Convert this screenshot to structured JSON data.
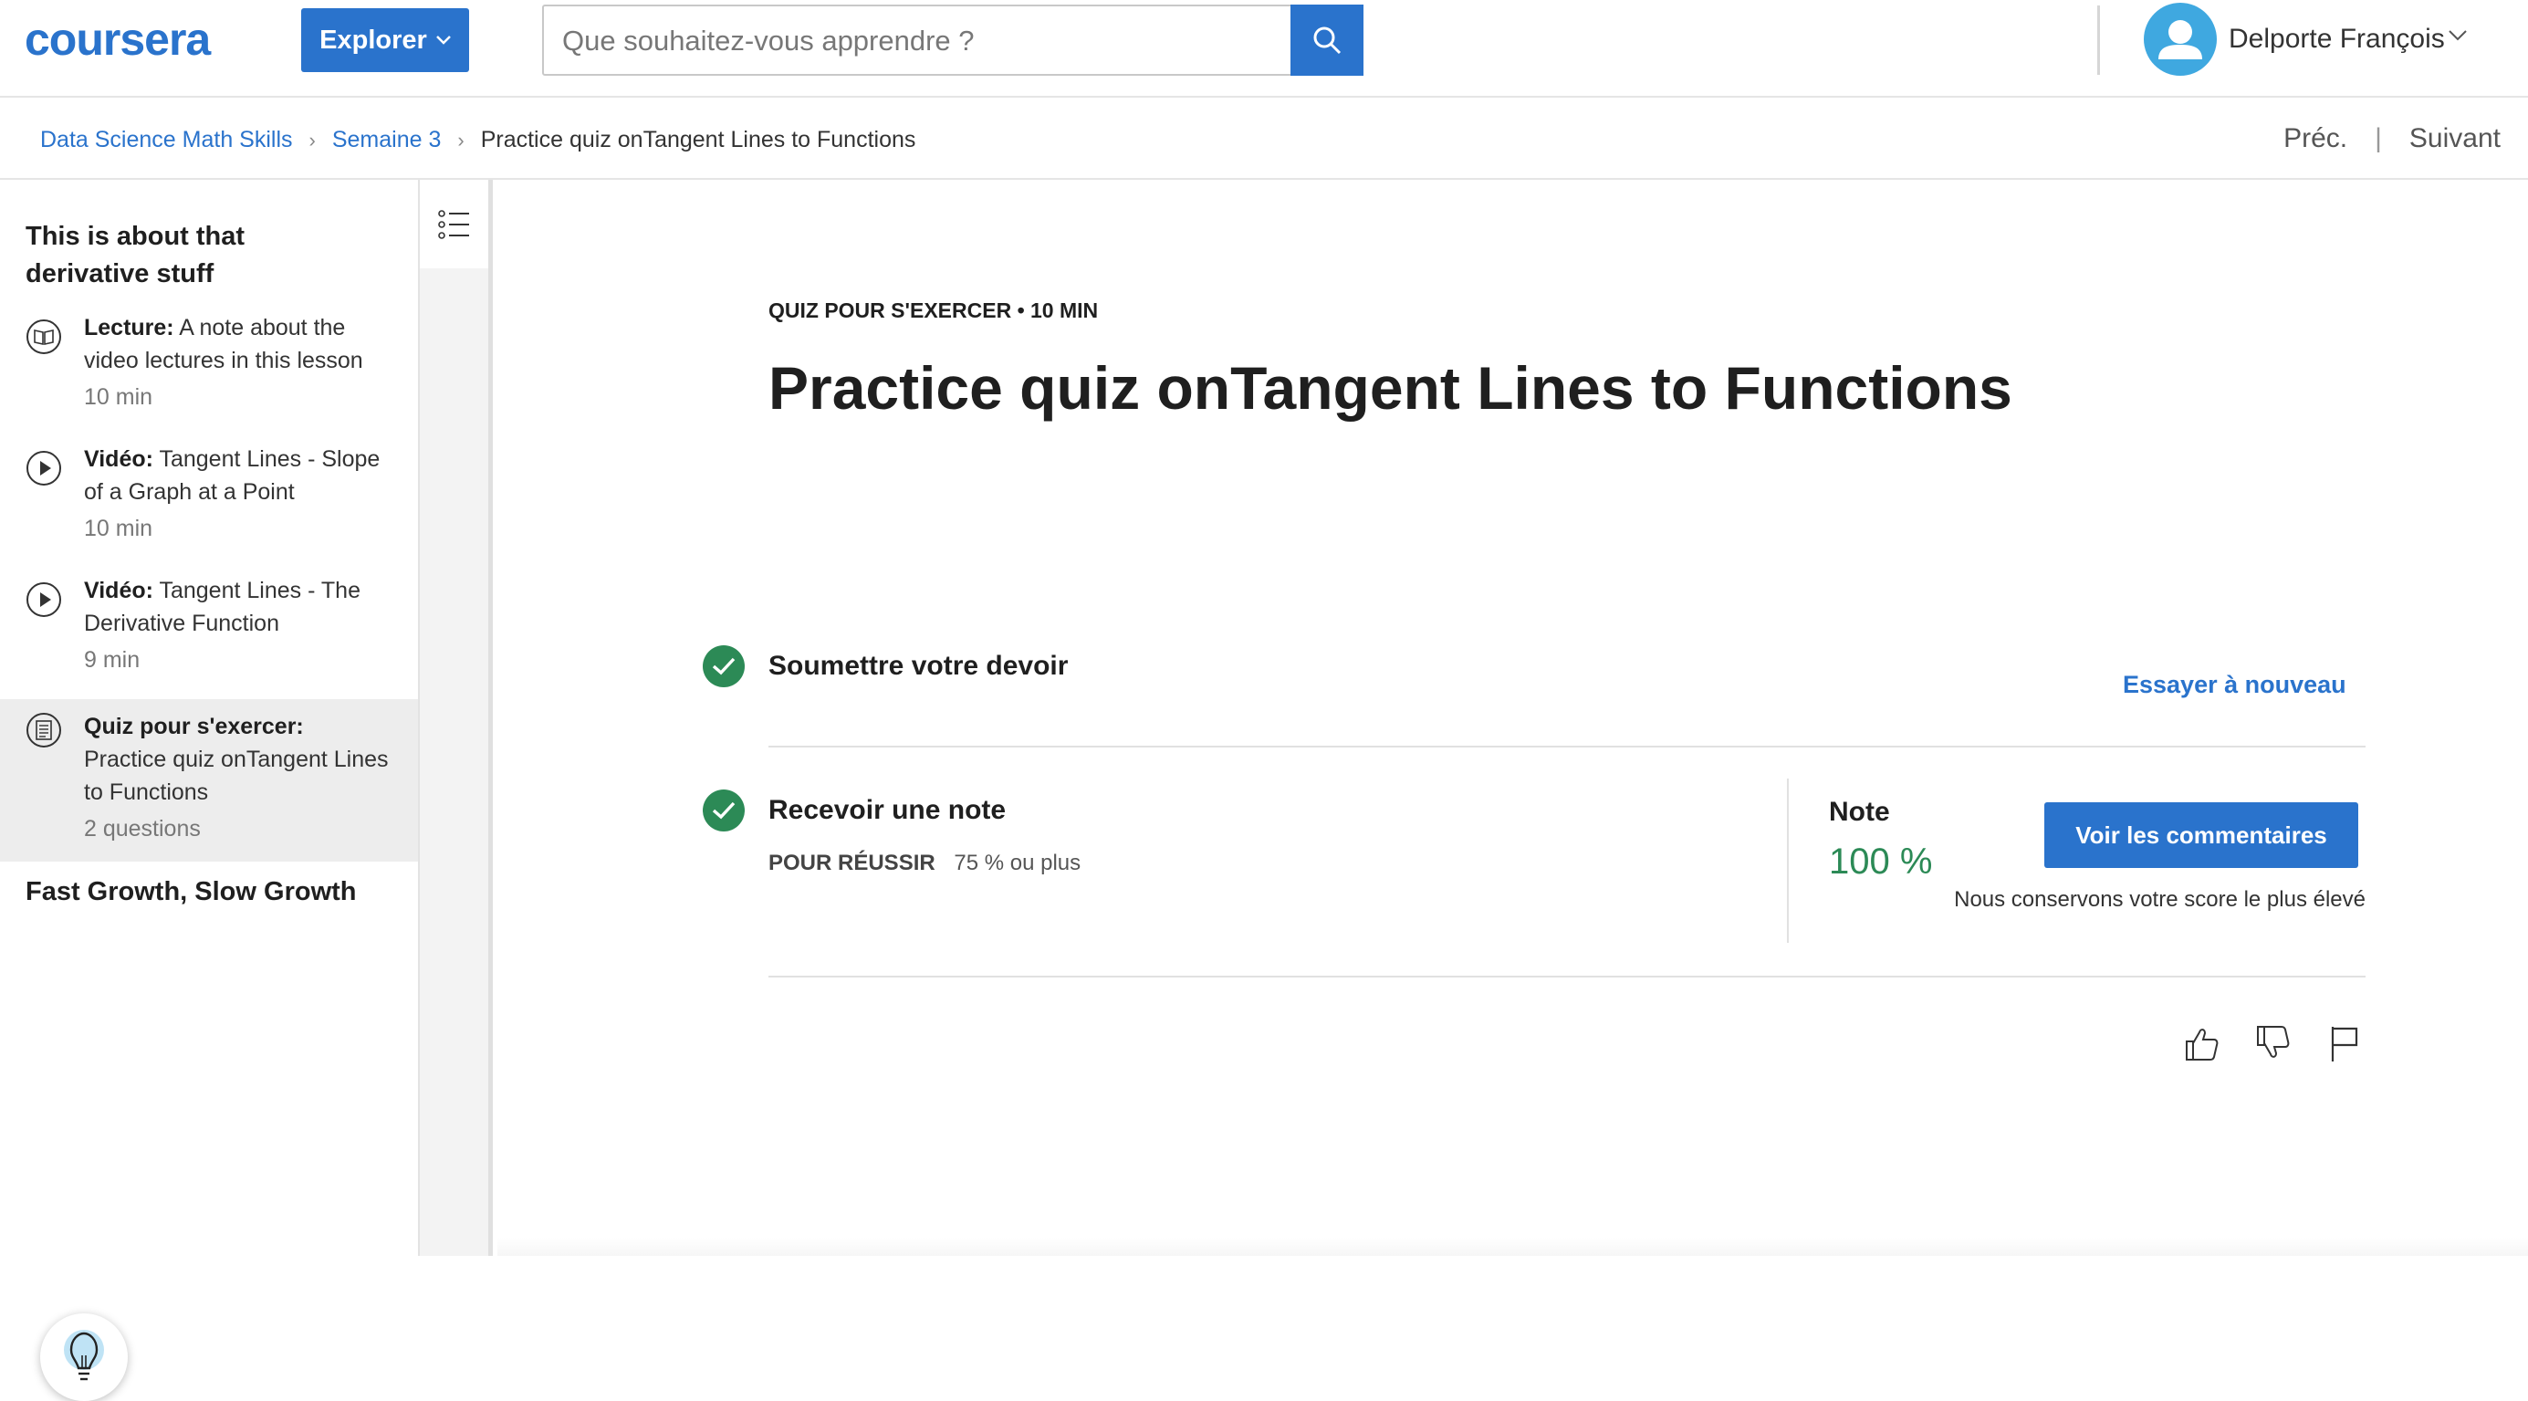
{
  "header": {
    "logo_text": "coursera",
    "explore_label": "Explorer",
    "search_placeholder": "Que souhaitez-vous apprendre ?",
    "user_name": "Delporte François"
  },
  "breadcrumb": {
    "items": [
      "Data Science Math Skills",
      "Semaine 3",
      "Practice quiz onTangent Lines to Functions"
    ],
    "prev_label": "Préc.",
    "next_label": "Suivant"
  },
  "sidebar": {
    "section_title": "This is about that derivative stuff",
    "items": [
      {
        "type": "Lecture:",
        "title": "A note about the video lectures in this lesson",
        "meta": "10  min",
        "icon": "reading-icon"
      },
      {
        "type": "Vidéo:",
        "title": "Tangent Lines - Slope of a Graph at a Point",
        "meta": "10  min",
        "icon": "play-icon"
      },
      {
        "type": "Vidéo:",
        "title": "Tangent Lines - The Derivative Function",
        "meta": "9  min",
        "icon": "play-icon"
      },
      {
        "type": "Quiz pour s'exercer:",
        "title": "Practice quiz onTangent Lines to Functions",
        "meta": "2 questions",
        "icon": "quiz-icon",
        "active": true
      }
    ],
    "next_section_title": "Fast Growth, Slow Growth"
  },
  "main": {
    "kicker": "QUIZ POUR S'EXERCER • 10  MIN",
    "title": "Practice quiz onTangent Lines to Functions",
    "submit_step": "Soumettre votre devoir",
    "retry_label": "Essayer à nouveau",
    "grade_step": "Recevoir une note",
    "pass_label": "POUR RÉUSSIR",
    "pass_value": "75 % ou plus",
    "note_label": "Note",
    "note_value": "100 %",
    "feedback_button": "Voir les commentaires",
    "keep_text": "Nous conservons votre score le plus élevé"
  },
  "colors": {
    "brand_blue": "#2a73cc",
    "success_green": "#2c8a56"
  }
}
